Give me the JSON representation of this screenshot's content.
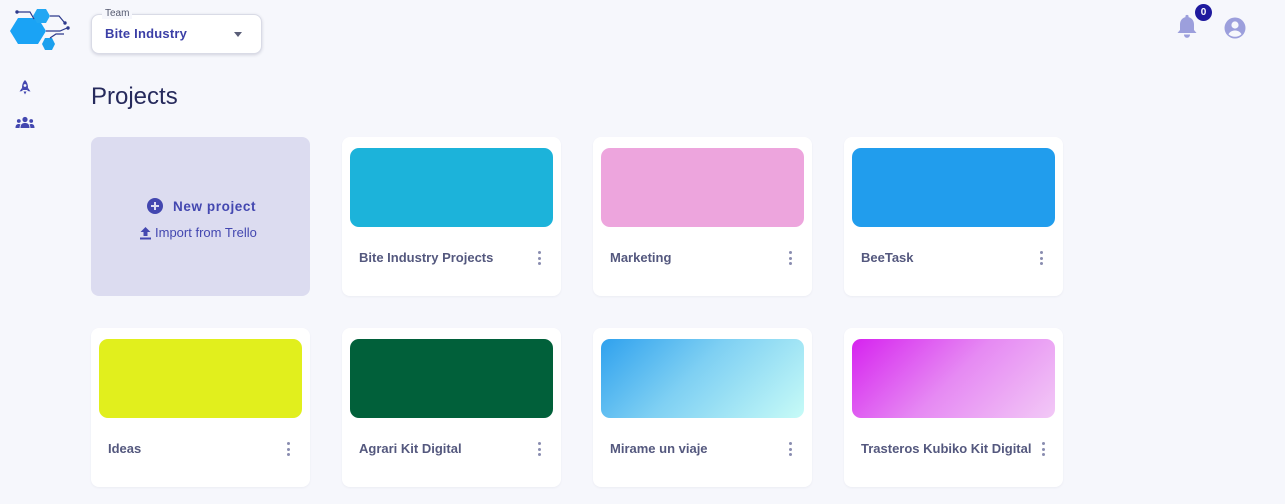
{
  "team_select": {
    "legend": "Team",
    "value": "Bite Industry"
  },
  "notifications": {
    "count": "0"
  },
  "page": {
    "title": "Projects"
  },
  "new_card": {
    "new_project": "New project",
    "import": "Import from Trello"
  },
  "projects": [
    {
      "name": "Bite Industry Projects",
      "cover": "#1cb3da"
    },
    {
      "name": "Marketing",
      "cover": "#eda5dd"
    },
    {
      "name": "BeeTask",
      "cover": "#219ded"
    },
    {
      "name": "Ideas",
      "cover": "#e1ef1d"
    },
    {
      "name": "Agrari Kit Digital",
      "cover": "#01603a"
    },
    {
      "name": "Mirame un viaje",
      "cover": "gradient: #2fa1ee → #c7fbf7"
    },
    {
      "name": "Trasteros Kubiko Kit Digital",
      "cover": "gradient: #d623ef → #f2c9f6"
    }
  ],
  "colors": {
    "accent": "#4347b0",
    "badge": "#1f1a9e",
    "new_card_bg": "#dcdcf0",
    "background": "#f6f7fc"
  },
  "icons": {
    "sidebar": [
      "rocket-icon",
      "team-icon"
    ],
    "topbar": [
      "bell-icon",
      "account-icon"
    ]
  }
}
